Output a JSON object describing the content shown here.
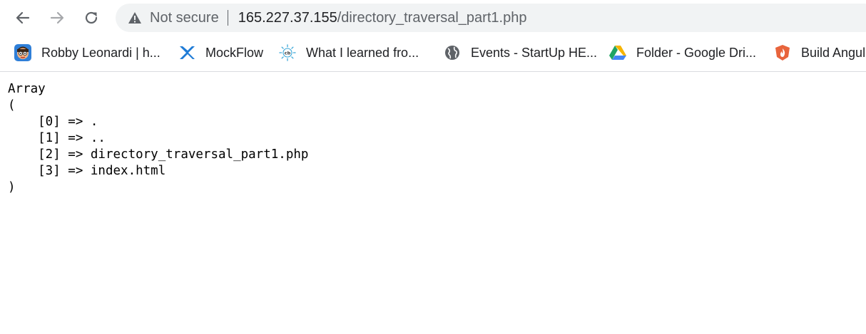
{
  "browser": {
    "security_label": "Not secure",
    "url_host": "165.227.37.155",
    "url_path": "/directory_traversal_part1.php",
    "icons": {
      "back": "arrow-back-icon",
      "forward": "arrow-forward-icon",
      "reload": "reload-icon",
      "security": "warning-triangle-icon"
    }
  },
  "bookmarks": [
    {
      "label": "Robby Leonardi | h...",
      "icon": "cartoon-avatar-icon"
    },
    {
      "label": "MockFlow",
      "icon": "mockflow-icon"
    },
    {
      "label": "What I learned fro...",
      "icon": "cb-badge-icon"
    },
    {
      "label": "Events - StartUp HE...",
      "icon": "globe-icon"
    },
    {
      "label": "Folder - Google Dri...",
      "icon": "google-drive-icon"
    },
    {
      "label": "Build Angul",
      "icon": "fire-shield-icon"
    }
  ],
  "page": {
    "lines": [
      "Array",
      "(",
      "    [0] => .",
      "    [1] => ..",
      "    [2] => directory_traversal_part1.php",
      "    [3] => index.html",
      ")"
    ]
  }
}
